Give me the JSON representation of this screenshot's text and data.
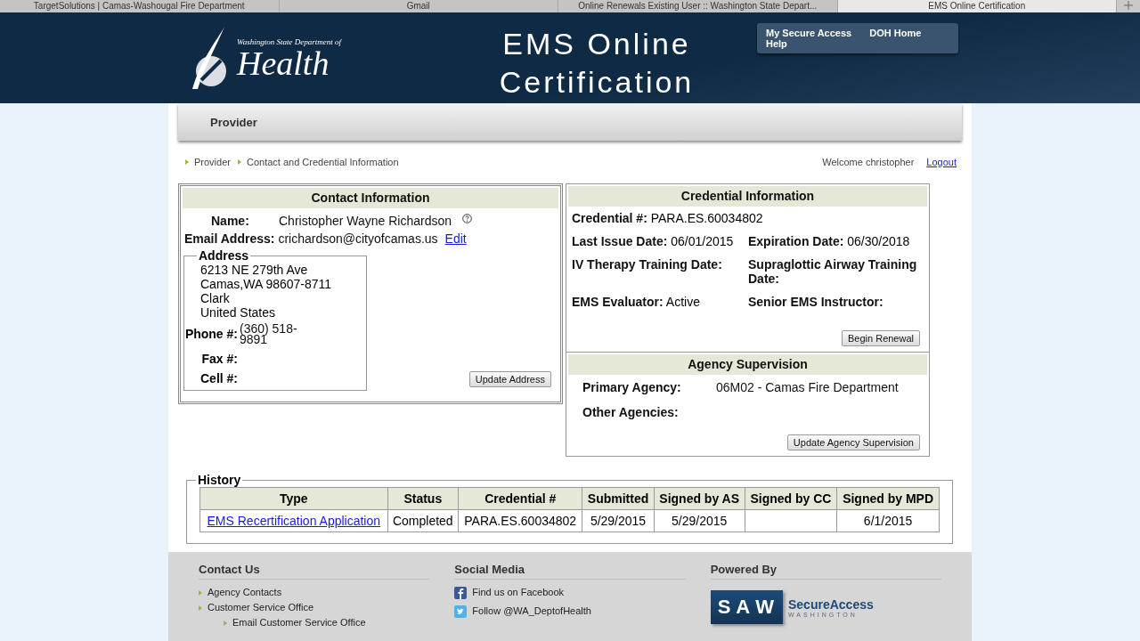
{
  "browser_tabs": [
    {
      "label": "TargetSolutions | Camas-Washougal Fire Department",
      "selected": false
    },
    {
      "label": "Gmail",
      "selected": false
    },
    {
      "label": "Online Renewals Existing User :: Washington State Depart...",
      "selected": false
    },
    {
      "label": "EMS Online Certification",
      "selected": true
    }
  ],
  "header": {
    "logo_small": "Washington State Department of",
    "logo_big": "Health",
    "title_line_1": "EMS Online",
    "title_line_2": "Certification",
    "links": [
      "My Secure Access",
      "DOH Home",
      "Help"
    ]
  },
  "nav": {
    "tab": "Provider"
  },
  "breadcrumb": [
    "Provider",
    "Contact and Credential Information"
  ],
  "welcome": "Welcome christopher",
  "logout": "Logout",
  "contact": {
    "title": "Contact Information",
    "name_label": "Name:",
    "name": "Christopher Wayne Richardson",
    "email_label": "Email Address:",
    "email": "crichardson@cityofcamas.us",
    "edit": "Edit",
    "address_legend": "Address",
    "address_lines": [
      "6213 NE 279th Ave",
      "Camas,WA 98607-8711",
      "Clark",
      "United States"
    ],
    "phones": [
      {
        "label": "Phone #:",
        "value": "(360) 518-9891"
      },
      {
        "label": "Fax #:"
      },
      {
        "label": "Cell #:"
      }
    ],
    "button": "Update Address"
  },
  "credential": {
    "title": "Credential Information",
    "fields": [
      {
        "label": "Credential #:",
        "value": "PARA.ES.60034802"
      },
      {
        "label": "Last Issue Date:",
        "value": "06/01/2015"
      },
      {
        "label": "Expiration Date:",
        "value": "06/30/2018"
      },
      {
        "label": "IV Therapy Training Date:"
      },
      {
        "label": "Supraglottic Airway Training Date:"
      },
      {
        "label": "EMS Evaluator:",
        "value": "Active"
      },
      {
        "label": "Senior EMS Instructor:"
      }
    ],
    "button": "Begin Renewal"
  },
  "agency": {
    "title": "Agency Supervision",
    "fields": [
      {
        "label": "Primary Agency:",
        "value": "06M02 - Camas Fire Department"
      },
      {
        "label": "Other Agencies:"
      }
    ],
    "button": "Update Agency Supervision"
  },
  "history": {
    "legend": "History",
    "columns": [
      "Type",
      "Status",
      "Credential #",
      "Submitted",
      "Signed by AS",
      "Signed by CC",
      "Signed by MPD"
    ],
    "rows": [
      [
        "EMS Recertification Application",
        "Completed",
        "PARA.ES.60034802",
        "5/29/2015",
        "5/29/2015",
        null,
        "6/1/2015"
      ]
    ]
  },
  "footer": {
    "contact_title": "Contact Us",
    "contact_links": [
      {
        "label": "Agency Contacts"
      },
      {
        "label": "Customer Service Office",
        "children": [
          {
            "label": "Email Customer Service Office"
          }
        ]
      }
    ],
    "social_title": "Social Media",
    "social": [
      {
        "kind": "facebook",
        "label": "Find us on Facebook"
      },
      {
        "kind": "twitter",
        "label": "Follow @WA_DeptofHealth"
      }
    ],
    "powered_title": "Powered By",
    "saw_letters": [
      "S",
      "A",
      "W"
    ],
    "saw_name": "SecureAccess",
    "saw_sub": "WASHINGTON"
  }
}
